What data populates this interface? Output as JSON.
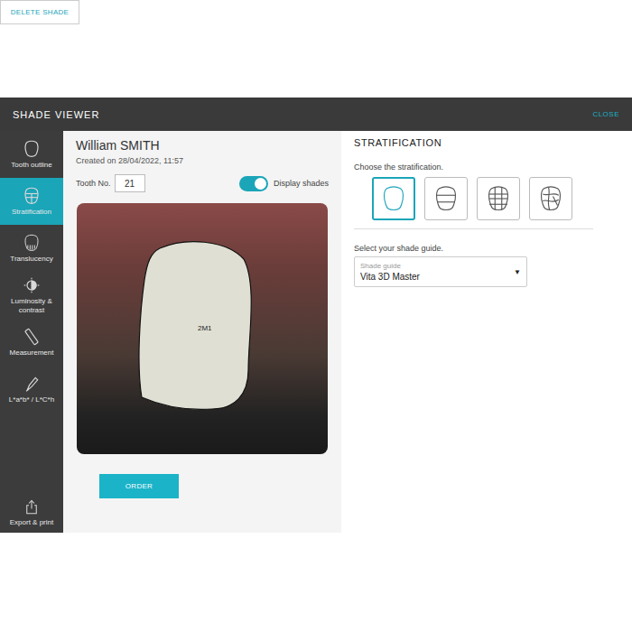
{
  "window": {
    "title": "SHADE VIEWER",
    "close": "CLOSE"
  },
  "sidebar": {
    "items": [
      {
        "label": "Tooth outline",
        "selected": false
      },
      {
        "label": "Stratification",
        "selected": true
      },
      {
        "label": "Translucency",
        "selected": false
      },
      {
        "label": "Luminosity & contrast",
        "selected": false
      },
      {
        "label": "Measurement",
        "selected": false
      },
      {
        "label": "L*a*b* / L*C*h",
        "selected": false
      }
    ],
    "footer": {
      "label": "Export & print",
      "selected": false
    }
  },
  "patient": {
    "name": "William SMITH",
    "created": "Created on 28/04/2022, 11:57"
  },
  "tooth": {
    "label": "Tooth No.",
    "value": "21"
  },
  "toggle": {
    "label": "Display shades",
    "on": true
  },
  "photo": {
    "shade": "2M1"
  },
  "buttons": [
    {
      "label": "DELETE SHADE",
      "kind": "outline"
    },
    {
      "label": "ORDER",
      "kind": "primary"
    }
  ],
  "stratification": {
    "title": "STRATIFICATION",
    "prompt": "Choose the stratification.",
    "options": [
      {
        "selected": true
      },
      {
        "selected": false
      },
      {
        "selected": false
      },
      {
        "selected": false
      }
    ]
  },
  "shade_guide": {
    "prompt": "Select your shade guide.",
    "label": "Shade guide",
    "value": "Vita 3D Master",
    "caret": "▼"
  }
}
